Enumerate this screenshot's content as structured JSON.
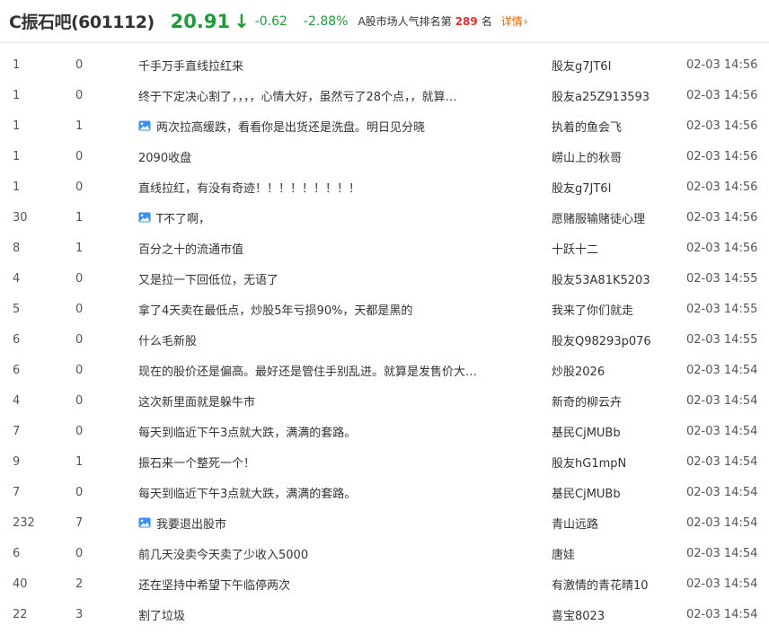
{
  "header": {
    "stock_name": "C振石吧(601112)",
    "price": "20.91",
    "change": "-0.62",
    "change_pct": "-2.88%",
    "rank_label": "A股市场人气排名第",
    "rank_value": "289",
    "rank_unit": "名",
    "details_label": "详情"
  },
  "colors": {
    "price_down": "#1f9b3a",
    "rank_highlight": "#e0312b",
    "details_link": "#e06500",
    "image_icon": "#3b8ff3"
  },
  "posts": [
    {
      "reads": "1",
      "replies": "0",
      "has_image": false,
      "title": "千手万手直线拉红来",
      "author": "股友g7JT6I",
      "time": "02-03 14:56"
    },
    {
      "reads": "1",
      "replies": "0",
      "has_image": false,
      "title": "终于下定决心割了，，，，心情大好，虽然亏了28个点，，就算…",
      "author": "股友a25Z913593",
      "time": "02-03 14:56"
    },
    {
      "reads": "1",
      "replies": "1",
      "has_image": true,
      "title": "两次拉高缓跌，看看你是出货还是洗盘。明日见分晓",
      "author": "执着的鱼会飞",
      "time": "02-03 14:56"
    },
    {
      "reads": "1",
      "replies": "0",
      "has_image": false,
      "title": "2090收盘",
      "author": "崂山上的秋哥",
      "time": "02-03 14:56"
    },
    {
      "reads": "1",
      "replies": "0",
      "has_image": false,
      "title": "直线拉红，有没有奇迹！！！！！！！！！",
      "author": "股友g7JT6I",
      "time": "02-03 14:56"
    },
    {
      "reads": "30",
      "replies": "1",
      "has_image": true,
      "title": "T不了啊，",
      "author": "愿赌服输赌徒心理",
      "time": "02-03 14:56"
    },
    {
      "reads": "8",
      "replies": "1",
      "has_image": false,
      "title": "百分之十的流通市值",
      "author": "十跃十二",
      "time": "02-03 14:56"
    },
    {
      "reads": "4",
      "replies": "0",
      "has_image": false,
      "title": "又是拉一下回低位，无语了",
      "author": "股友53A81K5203",
      "time": "02-03 14:55"
    },
    {
      "reads": "5",
      "replies": "0",
      "has_image": false,
      "title": "拿了4天卖在最低点，炒股5年亏损90%，天都是黑的",
      "author": "我来了你们就走",
      "time": "02-03 14:55"
    },
    {
      "reads": "6",
      "replies": "0",
      "has_image": false,
      "title": "什么毛新股",
      "author": "股友Q98293p076",
      "time": "02-03 14:55"
    },
    {
      "reads": "6",
      "replies": "0",
      "has_image": false,
      "title": "现在的股价还是偏高。最好还是管住手别乱进。就算是发售价大…",
      "author": "炒股2026",
      "time": "02-03 14:54"
    },
    {
      "reads": "4",
      "replies": "0",
      "has_image": false,
      "title": "这次新里面就是躲牛市",
      "author": "新奇的柳云卉",
      "time": "02-03 14:54"
    },
    {
      "reads": "7",
      "replies": "0",
      "has_image": false,
      "title": "每天到临近下午3点就大跌，满满的套路。",
      "author": "基民CjMUBb",
      "time": "02-03 14:54"
    },
    {
      "reads": "9",
      "replies": "1",
      "has_image": false,
      "title": "振石来一个整死一个！",
      "author": "股友hG1mpN",
      "time": "02-03 14:54"
    },
    {
      "reads": "7",
      "replies": "0",
      "has_image": false,
      "title": "每天到临近下午3点就大跌，满满的套路。",
      "author": "基民CjMUBb",
      "time": "02-03 14:54"
    },
    {
      "reads": "232",
      "replies": "7",
      "has_image": true,
      "title": "我要退出股市",
      "author": "青山远路",
      "time": "02-03 14:54"
    },
    {
      "reads": "6",
      "replies": "0",
      "has_image": false,
      "title": "前几天没卖今天卖了少收入5000",
      "author": "唐娃",
      "time": "02-03 14:54"
    },
    {
      "reads": "40",
      "replies": "2",
      "has_image": false,
      "title": "还在坚持中希望下午临停两次",
      "author": "有激情的青花晴10",
      "time": "02-03 14:54"
    },
    {
      "reads": "22",
      "replies": "3",
      "has_image": false,
      "title": "割了垃圾",
      "author": "喜宝8023",
      "time": "02-03 14:54"
    }
  ]
}
